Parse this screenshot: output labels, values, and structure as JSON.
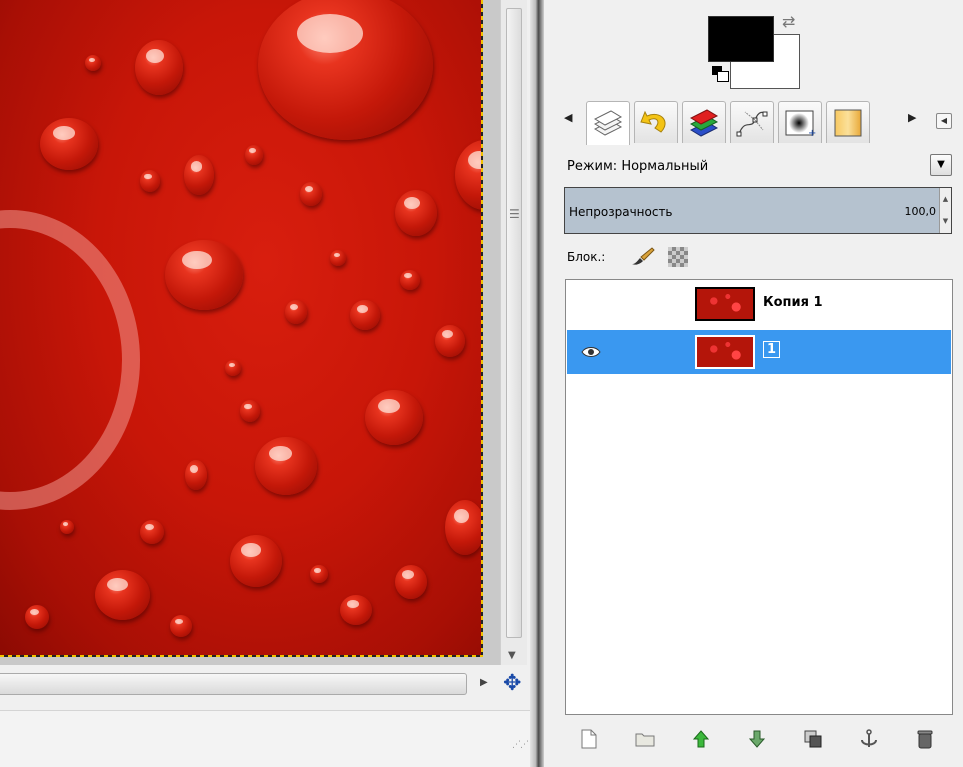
{
  "layers_dialog": {
    "mode_label": "Режим: Нормальный",
    "opacity_label": "Непрозрачность",
    "opacity_value": "100,0",
    "lock_label": "Блок.:",
    "layers": [
      {
        "name": "Копия 1",
        "visible": false,
        "selected": false
      },
      {
        "name": "1",
        "visible": true,
        "selected": true
      }
    ]
  },
  "colors": {
    "foreground": "#000000",
    "background": "#ffffff",
    "selection_highlight": "#3a98f0"
  },
  "tabs": [
    "layers-icon",
    "undo-history-icon",
    "channels-icon",
    "paths-icon",
    "brushes-icon",
    "gradients-icon"
  ],
  "bottom_buttons": [
    "new-layer-icon",
    "layer-group-icon",
    "raise-layer-icon",
    "lower-layer-icon",
    "duplicate-layer-icon",
    "anchor-layer-icon",
    "delete-layer-icon"
  ]
}
